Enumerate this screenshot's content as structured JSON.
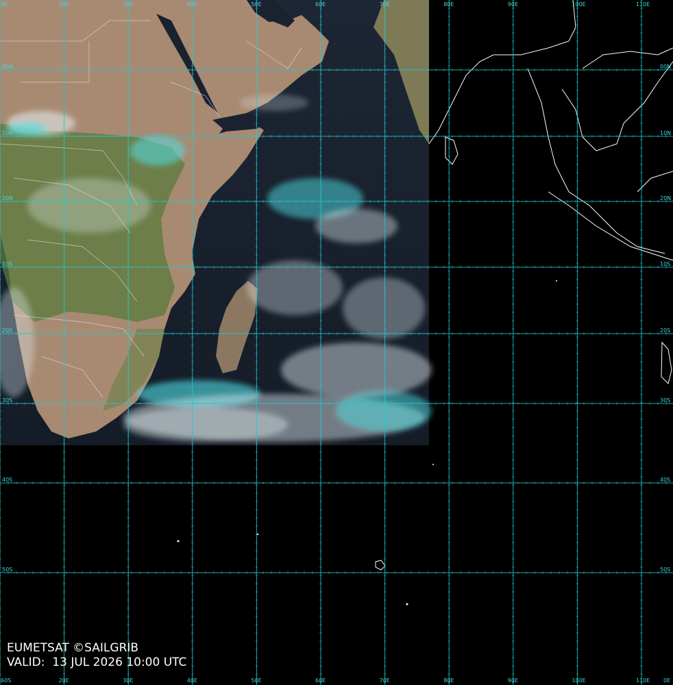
{
  "map": {
    "type": "satellite-composite",
    "region": "Indian Ocean",
    "lon_range": [
      10,
      115
    ],
    "lat_range": [
      -60,
      30
    ],
    "top_lon_labels": [
      "20E",
      "30E",
      "40E",
      "50E",
      "60E",
      "70E",
      "80E",
      "90E",
      "100E",
      "110E"
    ],
    "bottom_lon_labels": [
      "20E",
      "30E",
      "40E",
      "50E",
      "60E",
      "70E",
      "80E",
      "90E",
      "100E",
      "110E"
    ],
    "left_lat_labels": [
      "20N",
      "10N",
      "00N",
      "10S",
      "20S",
      "30S",
      "40S",
      "50S"
    ],
    "right_lat_labels": [
      "20N",
      "10N",
      "00N",
      "10S",
      "20S",
      "30S",
      "40S",
      "50S"
    ],
    "corner_labels": [
      "0E",
      "60S",
      "0E"
    ],
    "colors": {
      "grid": "#22c8d0",
      "ocean": "#1c2633",
      "desert": "#a88a72",
      "vegetation": "#5a7a3c",
      "cloud": "#e6f2f6",
      "cloud_ice": "#4fe0e6",
      "coastline": "#ffffff",
      "background": "#000000"
    }
  },
  "credit": {
    "line1": "EUMETSAT ©SAILGRIB",
    "line2": "VALID:  13 JUL 2026 10:00 UTC"
  }
}
